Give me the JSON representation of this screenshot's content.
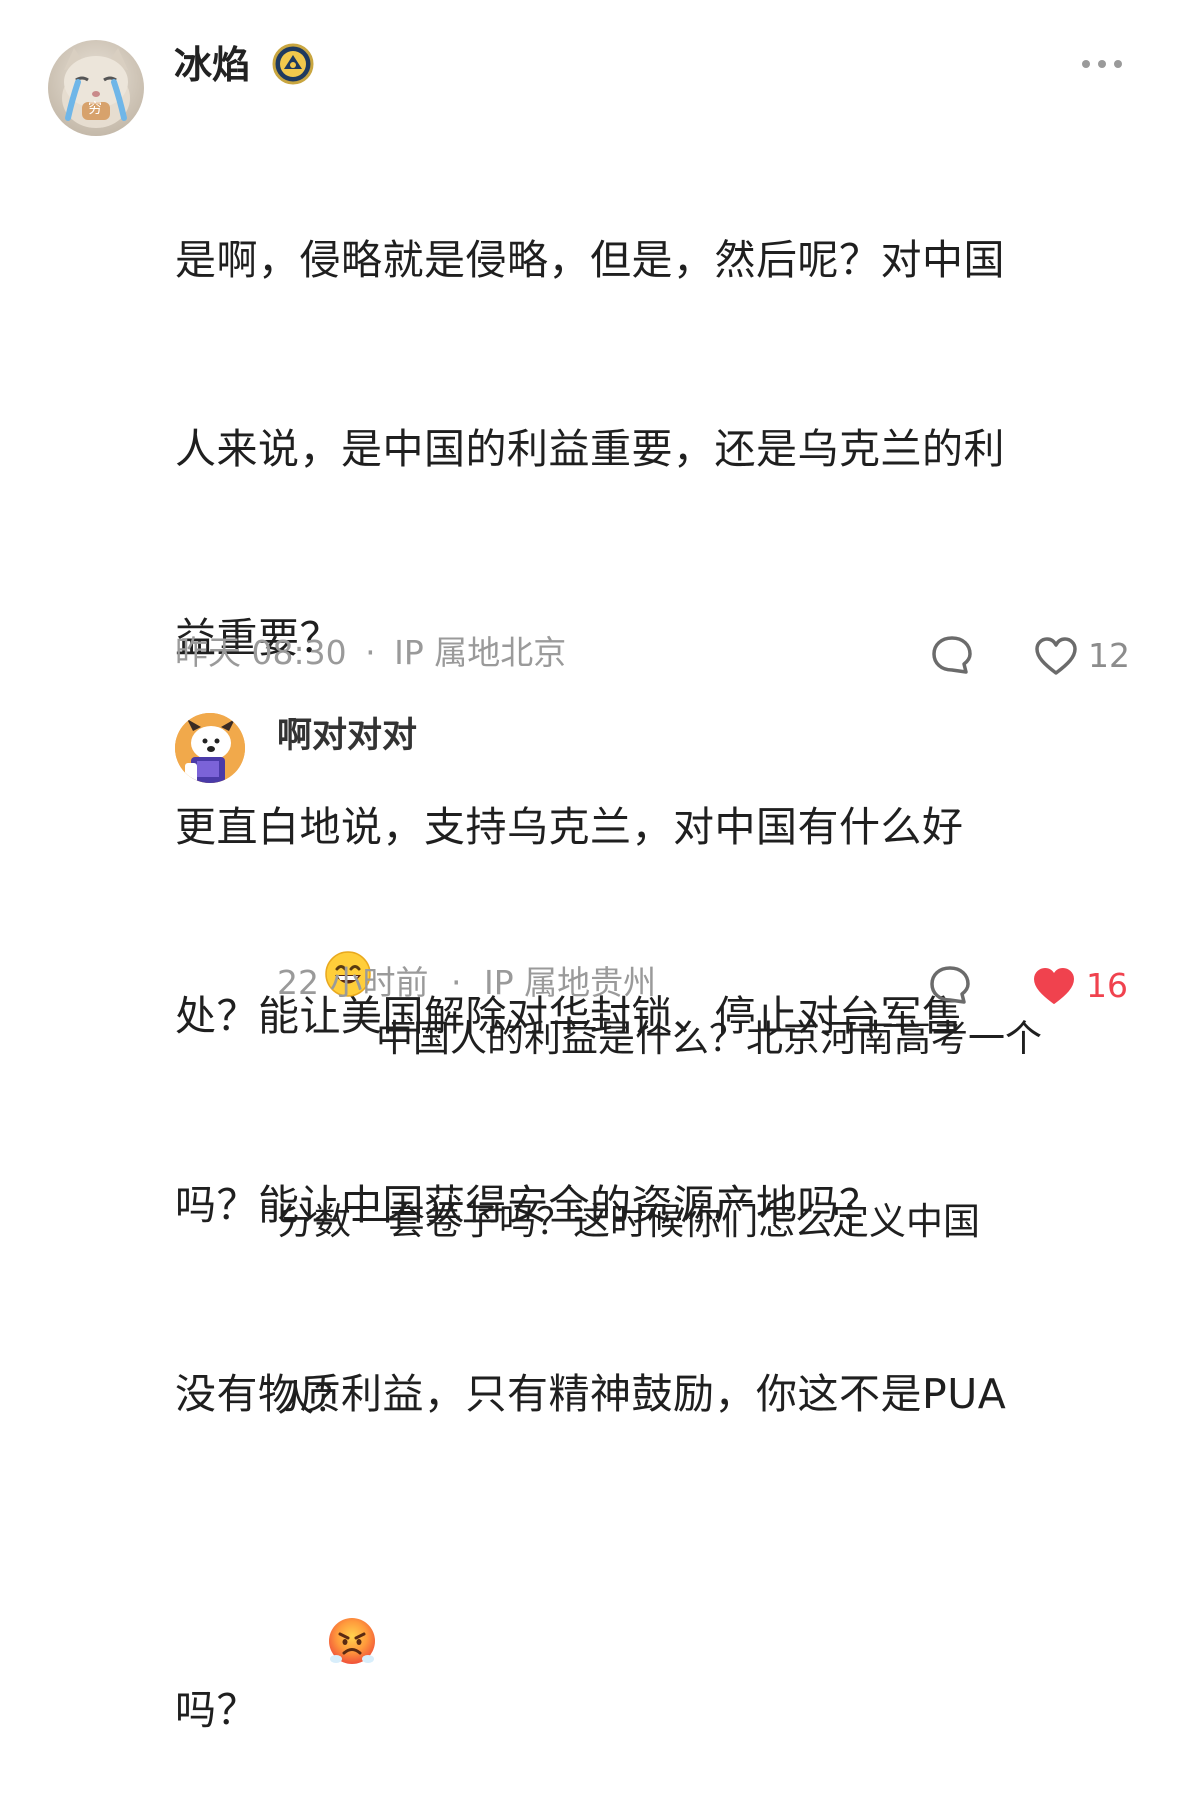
{
  "comment": {
    "username": "冰焰",
    "badge_icon": "verified-badge-icon",
    "more_icon": "more-dots-icon",
    "lines": [
      "是啊，侵略就是侵略，但是，然后呢？对中国",
      "人来说，是中国的利益重要，还是乌克兰的利",
      "益重要？",
      "更直白地说，支持乌克兰，对中国有什么好",
      "处？能让美国解除对华封锁、停止对台军售",
      "吗？能让中国获得安全的资源产地吗？",
      "没有物质利益，只有精神鼓励，你这不是PUA",
      "吗？"
    ],
    "emoji": "angry-face-emoji",
    "avatar_text": "穷",
    "time": "昨天 08:30",
    "separator": "·",
    "location": "IP 属地北京",
    "reply_icon": "comment-bubble-icon",
    "like_icon": "heart-outline-icon",
    "likes": "12"
  },
  "reply": {
    "username": "啊对对对",
    "emoji": "grinning-face-emoji",
    "lines": [
      "中国人的利益是什么？北京河南高考一个",
      "分数一套卷子吗？这时候你们怎么定义中国",
      "人？"
    ],
    "time": "22 小时前",
    "separator": "·",
    "location": "IP 属地贵州",
    "reply_icon": "comment-bubble-icon",
    "like_icon": "heart-filled-icon",
    "likes": "16",
    "like_color": "#f0424e"
  }
}
